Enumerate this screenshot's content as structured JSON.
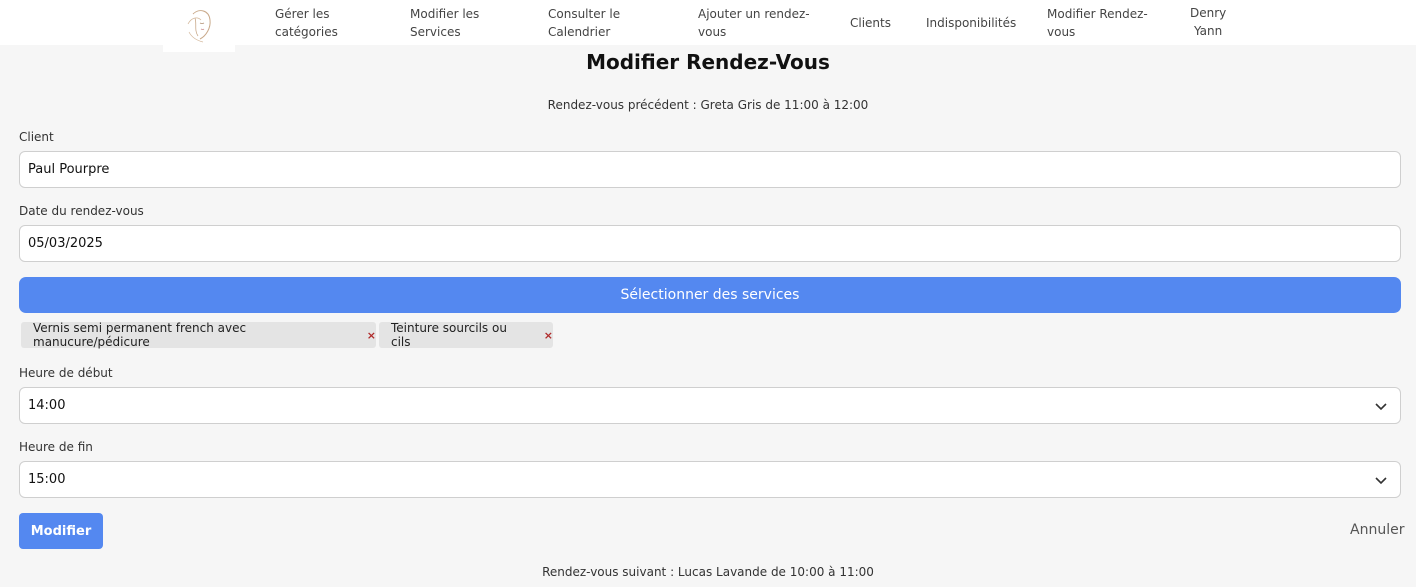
{
  "nav": {
    "items": [
      {
        "line1": "Gérer les",
        "line2": "catégories"
      },
      {
        "line1": "Modifier les",
        "line2": "Services"
      },
      {
        "line1": "Consulter le",
        "line2": "Calendrier"
      },
      {
        "line1": "Ajouter un rendez-",
        "line2": "vous"
      },
      {
        "line1": "Clients",
        "line2": ""
      },
      {
        "line1": "Indisponibilités",
        "line2": ""
      },
      {
        "line1": "Modifier Rendez-",
        "line2": "vous"
      }
    ],
    "user": {
      "line1": "Denry",
      "line2": "Yann"
    }
  },
  "page": {
    "title": "Modifier Rendez-Vous",
    "previous": "Rendez-vous précédent : Greta Gris de 11:00 à 12:00",
    "next": "Rendez-vous suivant : Lucas Lavande de 10:00 à 11:00"
  },
  "form": {
    "client_label": "Client",
    "client_value": "Paul Pourpre",
    "date_label": "Date du rendez-vous",
    "date_value": "05/03/2025",
    "services_button": "Sélectionner des services",
    "services": [
      "Vernis semi permanent french avec manucure/pédicure",
      "Teinture sourcils ou cils"
    ],
    "chip_remove": "×",
    "start_label": "Heure de début",
    "start_value": "14:00",
    "end_label": "Heure de fin",
    "end_value": "15:00",
    "submit": "Modifier",
    "cancel": "Annuler"
  },
  "colors": {
    "accent": "#5488f0",
    "remove": "#b02a2a"
  }
}
